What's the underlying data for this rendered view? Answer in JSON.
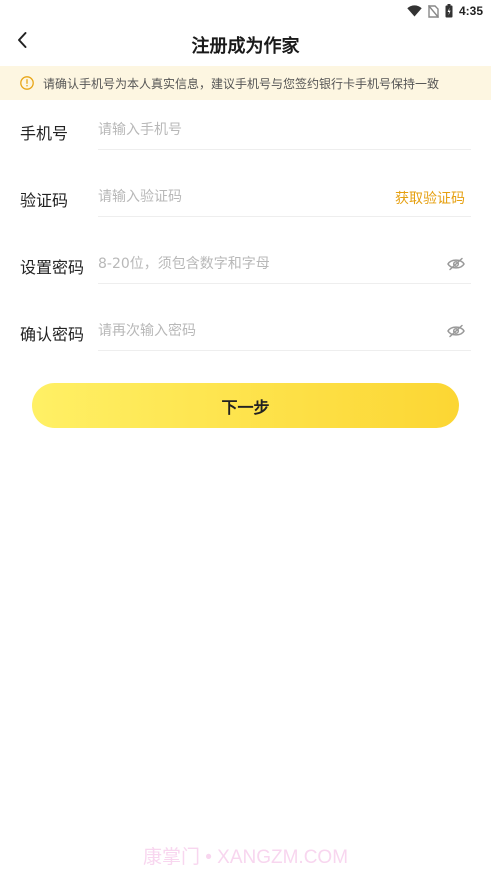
{
  "status_bar": {
    "time": "4:35"
  },
  "header": {
    "title": "注册成为作家"
  },
  "notice": {
    "text": "请确认手机号为本人真实信息，建议手机号与您签约银行卡手机号保持一致"
  },
  "form": {
    "phone": {
      "label": "手机号",
      "placeholder": "请输入手机号"
    },
    "code": {
      "label": "验证码",
      "placeholder": "请输入验证码",
      "action": "获取验证码"
    },
    "password": {
      "label": "设置密码",
      "placeholder": "8-20位，须包含数字和字母"
    },
    "confirm": {
      "label": "确认密码",
      "placeholder": "请再次输入密码"
    }
  },
  "next_button": {
    "label": "下一步"
  },
  "watermark": {
    "text": "康掌门 • XANGZM.COM"
  },
  "colors": {
    "accent": "#e6a011",
    "notice_bg": "#fdf6e1",
    "button_gradient_start": "#fff065",
    "button_gradient_end": "#fcd633"
  }
}
